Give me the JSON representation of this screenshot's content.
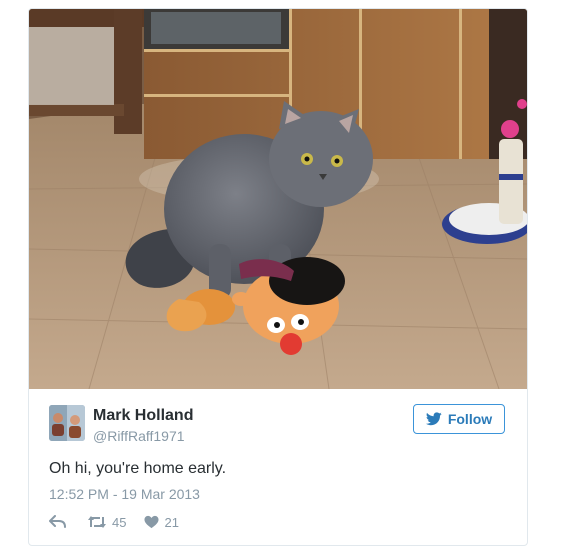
{
  "tweet": {
    "author_name": "Mark Holland",
    "author_handle": "@RiffRaff1971",
    "text": "Oh hi, you're home early.",
    "timestamp": "12:52 PM - 19 Mar 2013",
    "follow_label": "Follow",
    "retweet_count": "45",
    "like_count": "21"
  },
  "icons": {
    "reply": "reply-icon",
    "retweet": "retweet-icon",
    "like": "heart-icon",
    "follow": "twitter-bird-icon"
  },
  "colors": {
    "accent": "#2b7bb9",
    "follow_border": "#3b94d9",
    "text": "#292f33",
    "muted": "#8899a6",
    "card_border": "#e1e8ed"
  }
}
